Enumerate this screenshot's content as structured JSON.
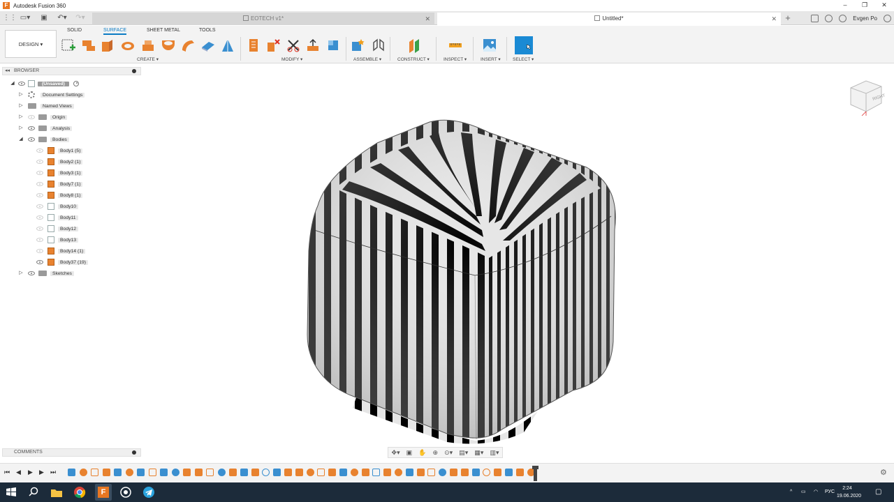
{
  "window": {
    "app_title": "Autodesk Fusion 360",
    "controls": {
      "minimize": "–",
      "maximize": "❐",
      "close": "✕"
    }
  },
  "tabs": [
    {
      "label": "EOTECH v1*",
      "active": false,
      "close": "✕"
    },
    {
      "label": "Untitled*",
      "active": true,
      "close": "✕"
    }
  ],
  "new_tab": "+",
  "user": "Evgen Po",
  "toolbar": {
    "workspace": "DESIGN ▾",
    "workspace_tabs": [
      "SOLID",
      "SURFACE",
      "SHEET METAL",
      "TOOLS"
    ],
    "active_workspace_tab": "SURFACE",
    "groups": {
      "create": "CREATE ▾",
      "modify": "MODIFY ▾",
      "assemble": "ASSEMBLE ▾",
      "construct": "CONSTRUCT ▾",
      "inspect": "INSPECT ▾",
      "insert": "INSERT ▾",
      "select": "SELECT ▾"
    }
  },
  "browser": {
    "title": "BROWSER",
    "root": "(Unsaved)",
    "items": [
      {
        "label": "Document Settings",
        "type": "settings"
      },
      {
        "label": "Named Views",
        "type": "folder"
      },
      {
        "label": "Origin",
        "type": "folder"
      },
      {
        "label": "Analysis",
        "type": "folder"
      },
      {
        "label": "Bodies",
        "type": "folder"
      },
      {
        "label": "Body1 (5)",
        "type": "body"
      },
      {
        "label": "Body2 (1)",
        "type": "body"
      },
      {
        "label": "Body3 (1)",
        "type": "body"
      },
      {
        "label": "Body7 (1)",
        "type": "body"
      },
      {
        "label": "Body8 (1)",
        "type": "body"
      },
      {
        "label": "Body10",
        "type": "surface"
      },
      {
        "label": "Body11",
        "type": "surface"
      },
      {
        "label": "Body12",
        "type": "surface"
      },
      {
        "label": "Body13",
        "type": "surface"
      },
      {
        "label": "Body14 (1)",
        "type": "body"
      },
      {
        "label": "Body37 (19)",
        "type": "body"
      },
      {
        "label": "Sketches",
        "type": "folder"
      }
    ]
  },
  "comments": {
    "title": "COMMENTS"
  },
  "viewcube": {
    "face": "RIGHT"
  },
  "colors": {
    "accent": "#0a7bc4",
    "body_orange": "#e8822f",
    "taskbar": "#1c2b3a"
  },
  "taskbar": {
    "lang": "РУС",
    "time": "2:24",
    "date": "19.06.2020",
    "tray_up": "^"
  }
}
